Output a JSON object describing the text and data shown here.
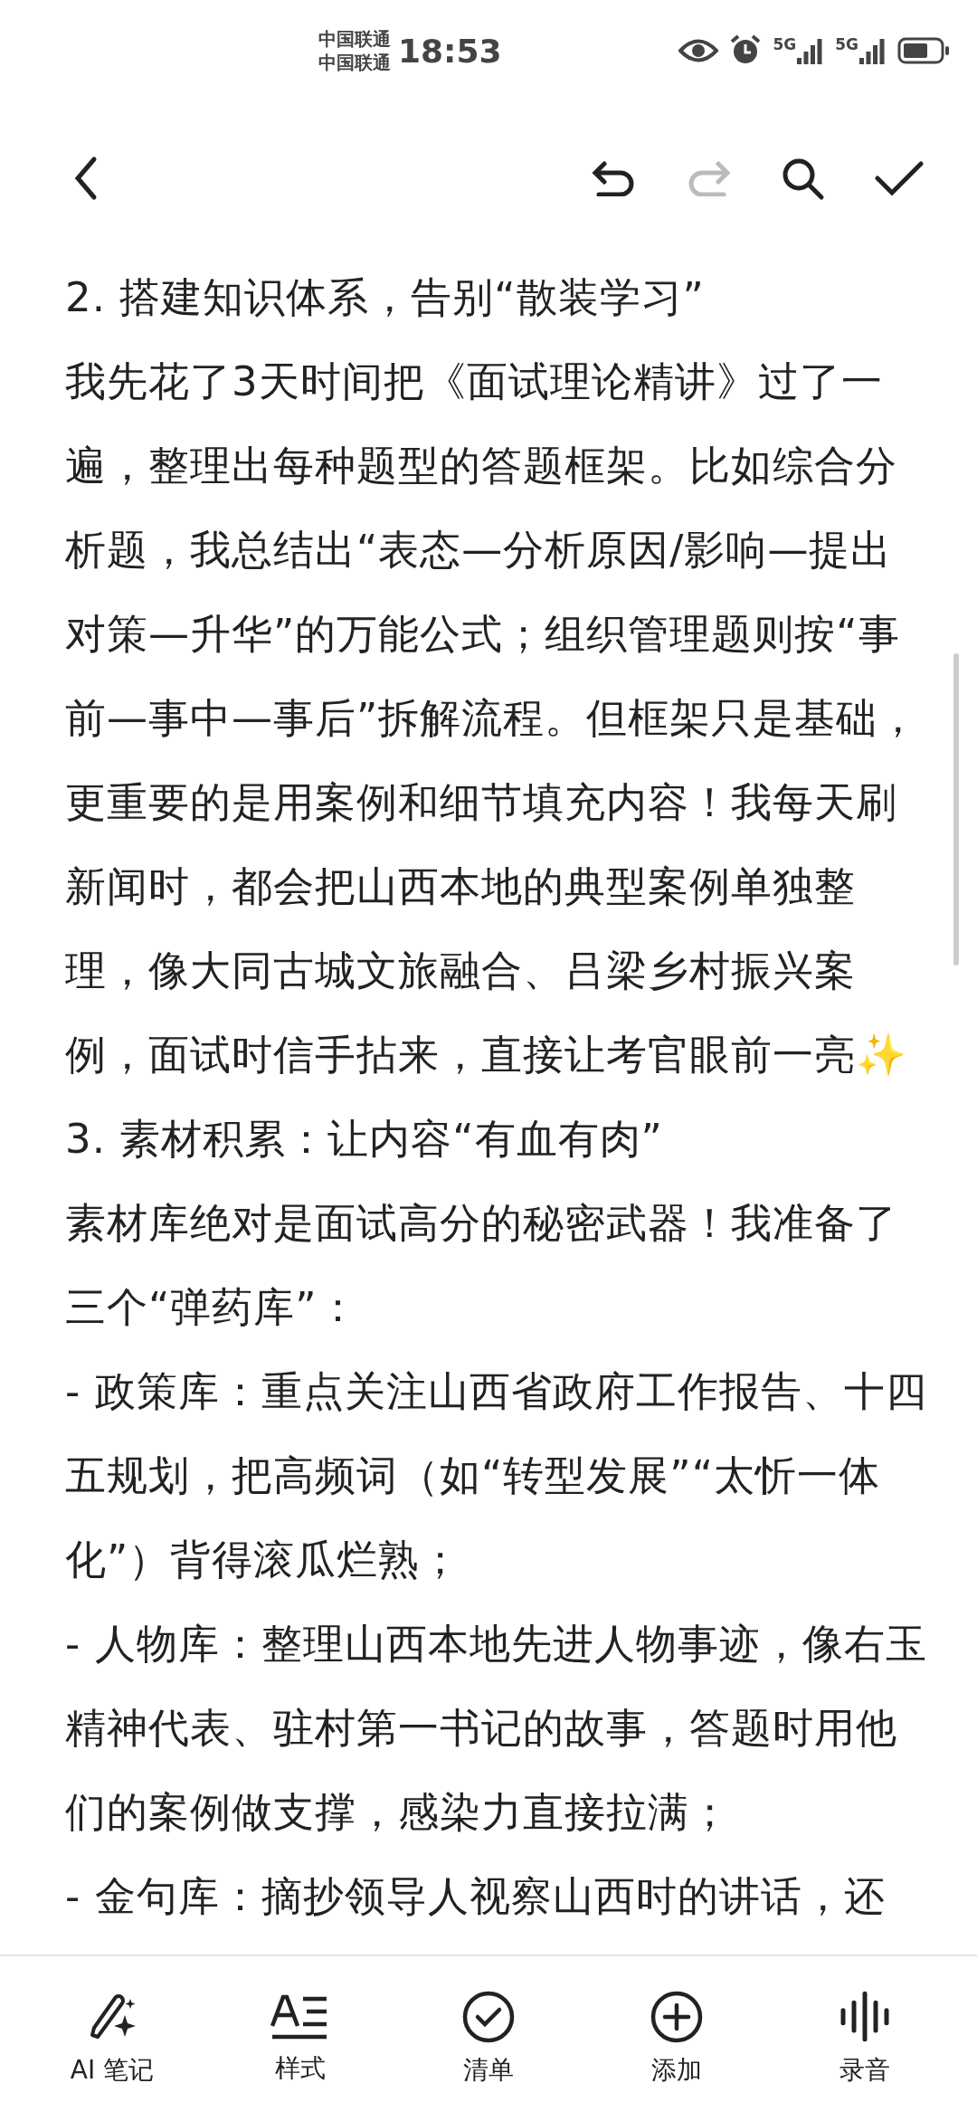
{
  "status_bar": {
    "carriers": [
      "中国联通",
      "中国联通"
    ],
    "time": "18:53",
    "network_labels": [
      "5G",
      "5G"
    ]
  },
  "toolbar": {
    "buttons": [
      {
        "kind": "back",
        "disabled": false
      },
      {
        "kind": "undo",
        "disabled": false
      },
      {
        "kind": "redo",
        "disabled": true
      },
      {
        "kind": "search",
        "disabled": false
      },
      {
        "kind": "done",
        "disabled": false
      }
    ]
  },
  "note": {
    "paragraphs": [
      "2. 搭建知识体系，告别“散装学习”",
      "我先花了3天时间把《面试理论精讲》过了一遍，整理出每种题型的答题框架。比如综合分析题，我总结出“表态—分析原因/影响—提出对策—升华”的万能公式；组织管理题则按“事前—事中—事后”拆解流程。但框架只是基础，更重要的是用案例和细节填充内容！我每天刷新闻时，都会把山西本地的典型案例单独整理，像大同古城文旅融合、吕梁乡村振兴案例，面试时信手拈来，直接让考官眼前一亮✨",
      "3. 素材积累：让内容“有血有肉”",
      "素材库绝对是面试高分的秘密武器！我准备了三个“弹药库”：",
      "- 政策库：重点关注山西省政府工作报告、十四五规划，把高频词（如“转型发展”“太忻一体化”）背得滚瓜烂熟；",
      "- 人物库：整理山西本地先进人物事迹，像右玉精神代表、驻村第一书记的故事，答题时用他们的案例做支撑，感染力直接拉满；",
      "- 金句库：摘抄领导人视察山西时的讲话，还"
    ]
  },
  "bottom_bar": {
    "items": [
      {
        "kind": "ai",
        "label": "AI 笔记"
      },
      {
        "kind": "style",
        "label": "样式"
      },
      {
        "kind": "checklist",
        "label": "清单"
      },
      {
        "kind": "add",
        "label": "添加"
      },
      {
        "kind": "record",
        "label": "录音"
      }
    ]
  }
}
